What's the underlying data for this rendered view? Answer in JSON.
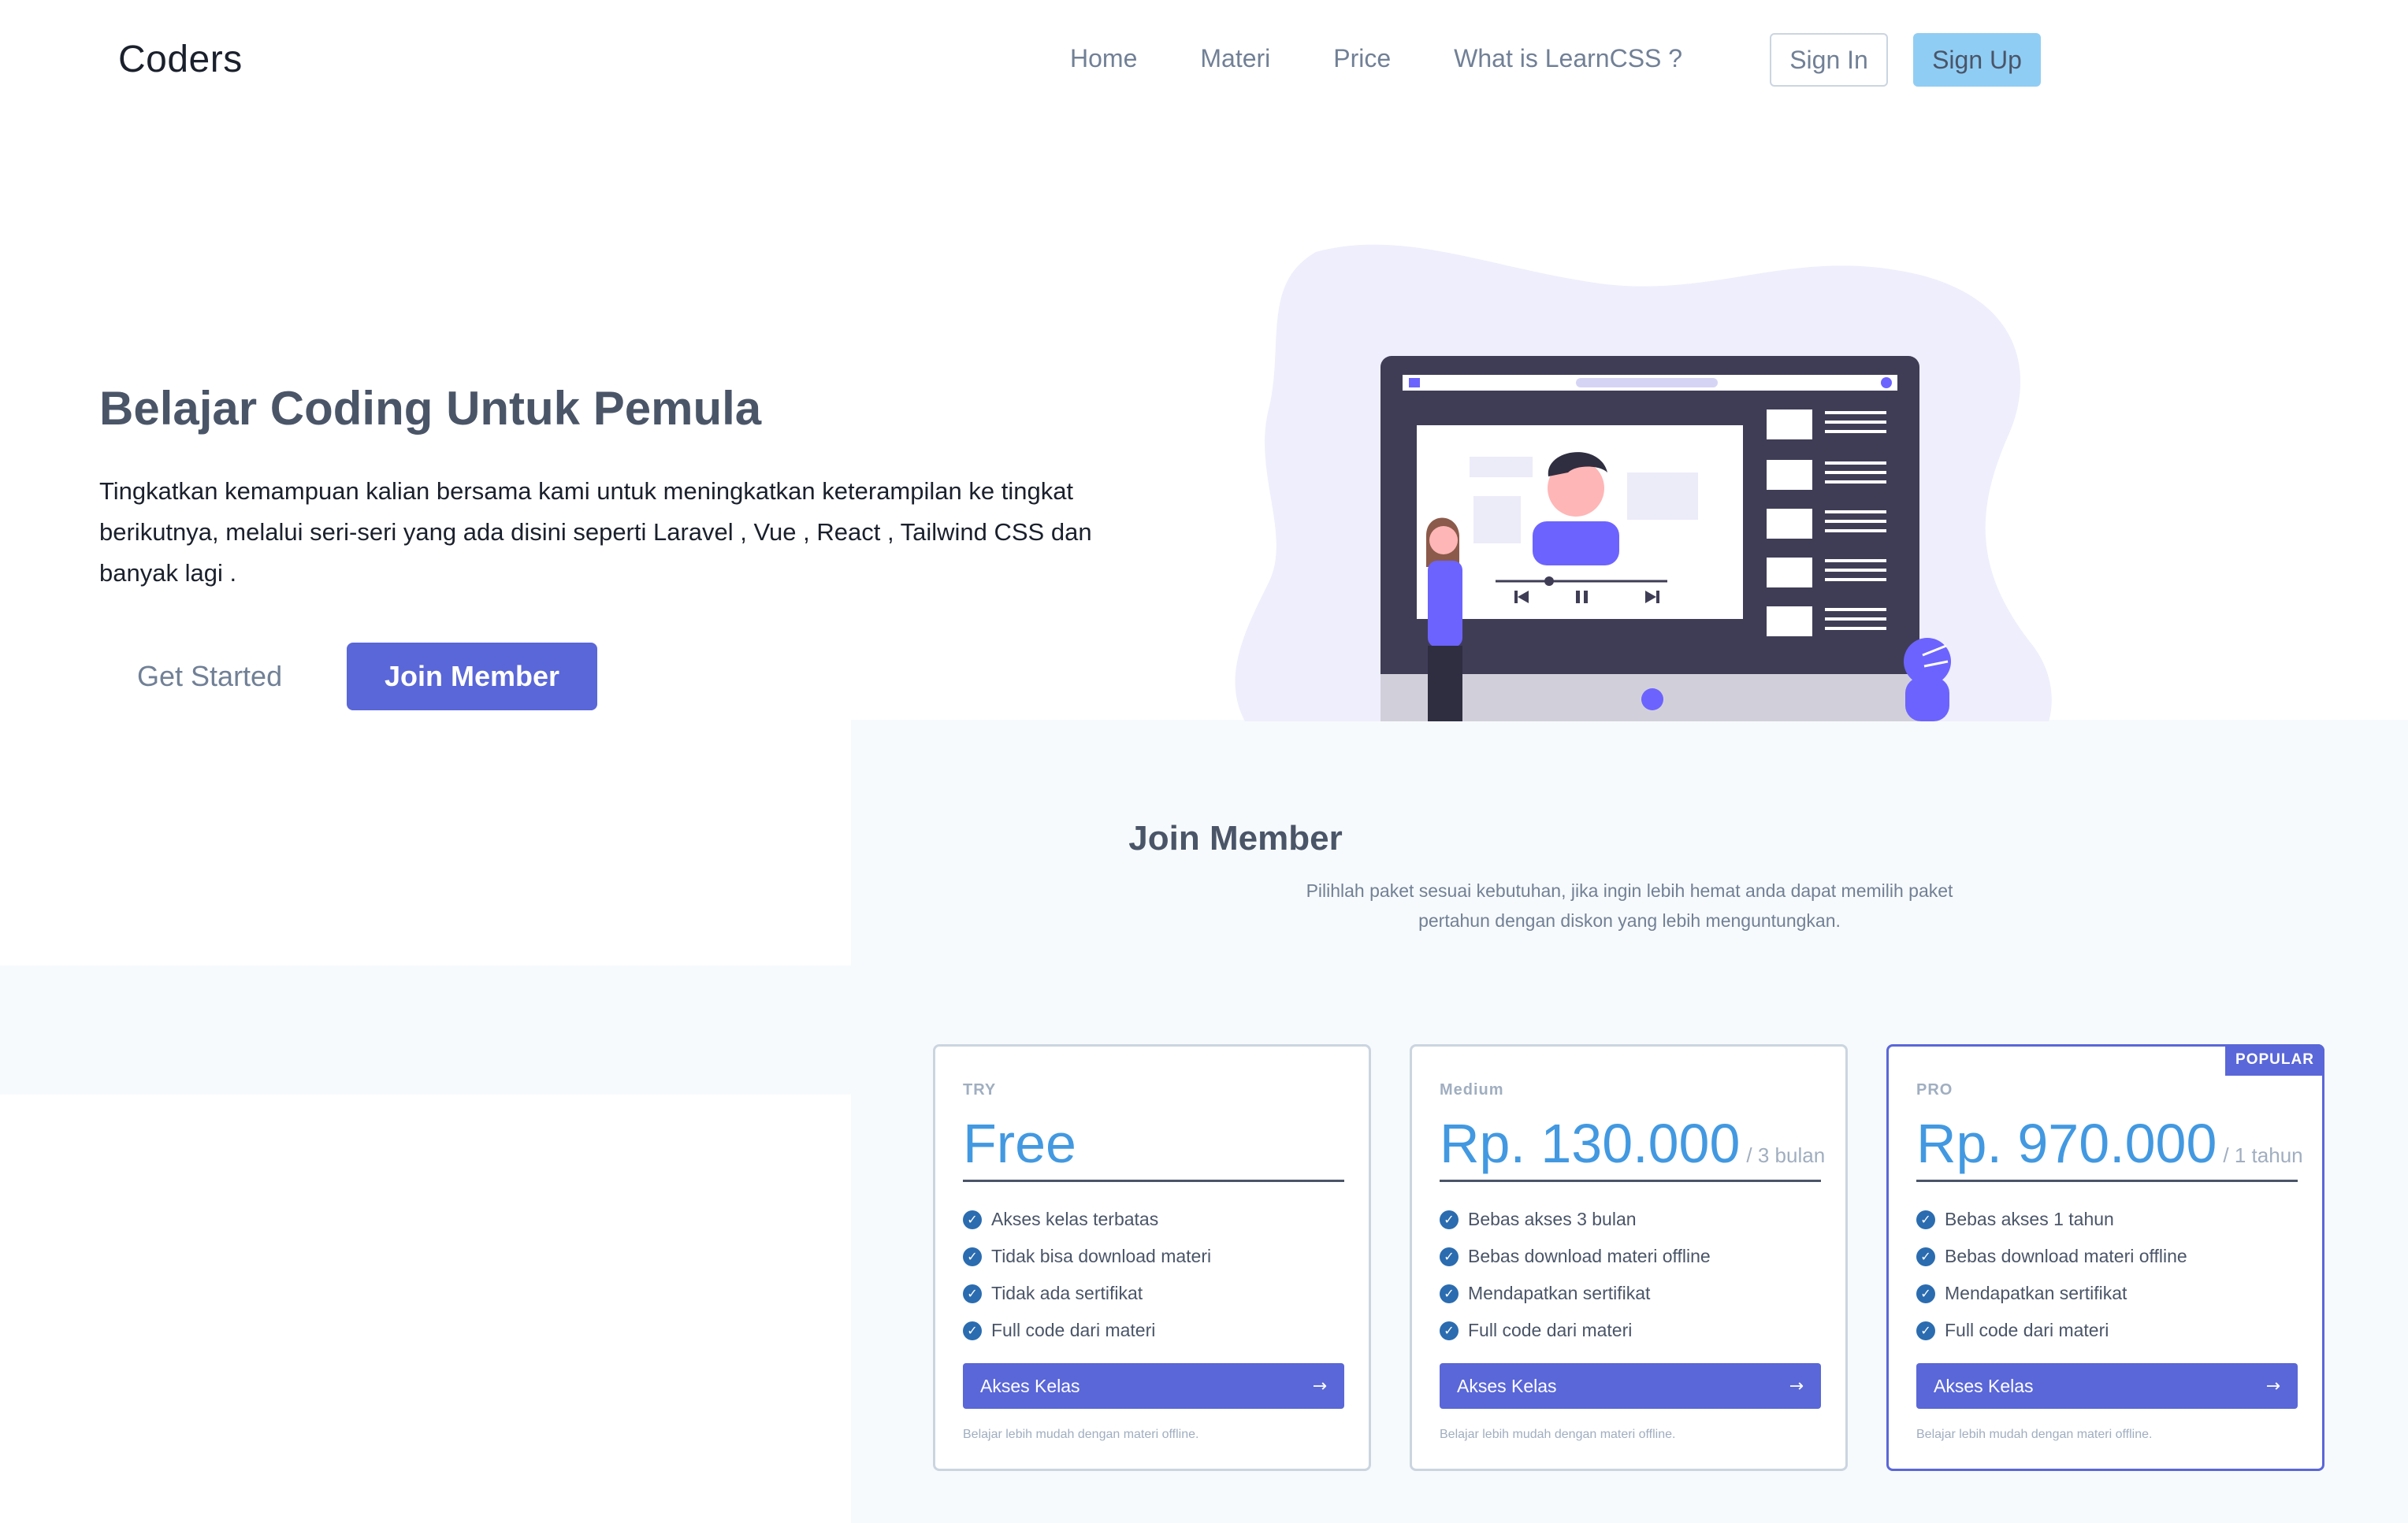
{
  "header": {
    "logo": "Coders",
    "nav": [
      "Home",
      "Materi",
      "Price",
      "What is LearnCSS ?"
    ],
    "sign_in": "Sign In",
    "sign_up": "Sign Up"
  },
  "hero": {
    "title": "Belajar Coding Untuk Pemula",
    "text": "Tingkatkan kemampuan kalian bersama kami untuk meningkatkan keterampilan ke tingkat berikutnya, melalui seri-seri yang ada disini seperti Laravel , Vue , React , Tailwind CSS dan banyak lagi .",
    "get_started": "Get Started",
    "join_member": "Join Member"
  },
  "pricing": {
    "title": "Join Member",
    "subtitle": "Pilihlah paket sesuai kebutuhan, jika ingin lebih hemat anda dapat memilih paket pertahun dengan diskon yang lebih menguntungkan.",
    "plans": [
      {
        "tier": "TRY",
        "price": "Free",
        "period": "",
        "features": [
          "Akses kelas terbatas",
          "Tidak bisa download materi",
          "Tidak ada sertifikat",
          "Full code dari materi"
        ],
        "cta": "Akses Kelas",
        "note": "Belajar lebih mudah dengan materi offline."
      },
      {
        "tier": "Medium",
        "price": "Rp. 130.000",
        "period": "/ 3 bulan",
        "features": [
          "Bebas akses 3 bulan",
          "Bebas download materi offline",
          "Mendapatkan sertifikat",
          "Full code dari materi"
        ],
        "cta": "Akses Kelas",
        "note": "Belajar lebih mudah dengan materi offline."
      },
      {
        "tier": "PRO",
        "badge": "POPULAR",
        "price": "Rp. 970.000",
        "period": "/ 1 tahun",
        "features": [
          "Bebas akses 1 tahun",
          "Bebas download materi offline",
          "Mendapatkan sertifikat",
          "Full code dari materi"
        ],
        "cta": "Akses Kelas",
        "note": "Belajar lebih mudah dengan materi offline."
      }
    ]
  },
  "colors": {
    "primary": "#5a67d8",
    "price_blue": "#4299e1",
    "signup_bg": "#90cdf4",
    "check": "#2b6cb0",
    "section_bg": "#f7fafc"
  },
  "icons": {
    "feature": "check-circle-icon",
    "cta": "arrow-right-icon"
  }
}
